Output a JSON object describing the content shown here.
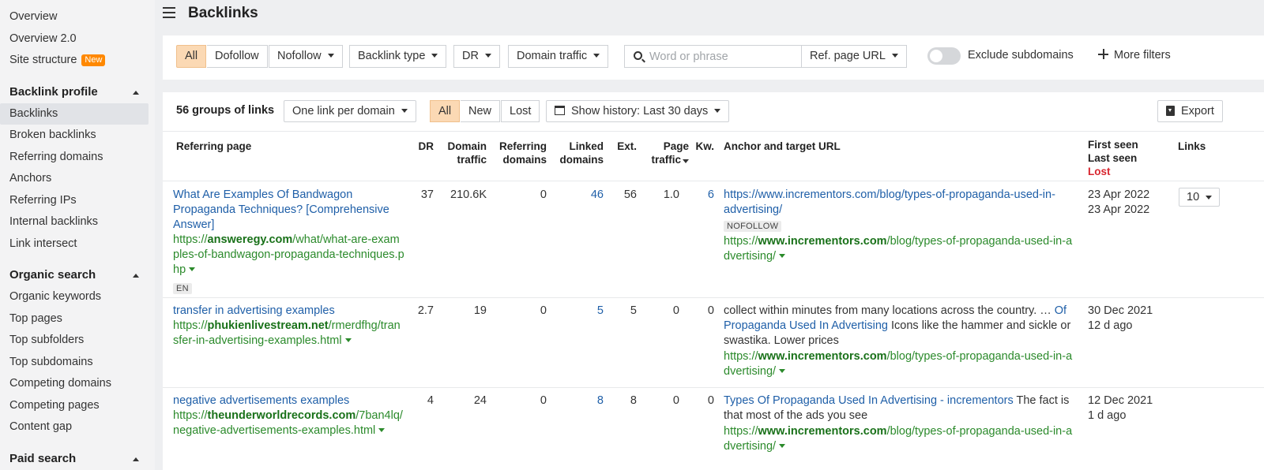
{
  "sidebar": {
    "top_items": [
      "Overview",
      "Overview 2.0",
      "Site structure"
    ],
    "new_badge": "New",
    "backlink_profile": {
      "title": "Backlink profile",
      "items": [
        "Backlinks",
        "Broken backlinks",
        "Referring domains",
        "Anchors",
        "Referring IPs",
        "Internal backlinks",
        "Link intersect"
      ]
    },
    "organic_search": {
      "title": "Organic search",
      "items": [
        "Organic keywords",
        "Top pages",
        "Top subfolders",
        "Top subdomains",
        "Competing domains",
        "Competing pages",
        "Content gap"
      ]
    },
    "paid_search": {
      "title": "Paid search"
    }
  },
  "header": {
    "title": "Backlinks"
  },
  "filters": {
    "all": "All",
    "dofollow": "Dofollow",
    "nofollow": "Nofollow",
    "backlink_type": "Backlink type",
    "dr": "DR",
    "domain_traffic": "Domain traffic",
    "search_placeholder": "Word or phrase",
    "ref_page_url": "Ref. page URL",
    "exclude_subdomains": "Exclude subdomains",
    "more_filters": "More filters"
  },
  "toolbar": {
    "groups": "56 groups of links",
    "grouping": "One link per domain",
    "all": "All",
    "new": "New",
    "lost": "Lost",
    "history": "Show history: Last 30 days",
    "export": "Export"
  },
  "columns": {
    "referring_page": "Referring page",
    "dr": "DR",
    "domain_traffic_1": "Domain",
    "domain_traffic_2": "traffic",
    "referring_domains_1": "Referring",
    "referring_domains_2": "domains",
    "linked_domains_1": "Linked",
    "linked_domains_2": "domains",
    "ext": "Ext.",
    "page_traffic_1": "Page",
    "page_traffic_2": "traffic",
    "kw": "Kw.",
    "anchor": "Anchor and target URL",
    "first_seen": "First seen",
    "last_seen": "Last seen",
    "lost": "Lost",
    "links": "Links"
  },
  "rows": [
    {
      "title": [
        "What Are Examples Of Bandwagon",
        "Propaganda Techniques? [Comprehensive",
        "Answer]"
      ],
      "url_prefix": "https://",
      "url_domain": "answeregy.com",
      "url_rest_1": "/what/what-are-exam",
      "url_rest_2": "ples-of-bandwagon-propaganda-techniques.p",
      "url_rest_3": "hp",
      "lang": "EN",
      "dr": "37",
      "domain_traffic": "210.6K",
      "referring_domains": "0",
      "linked_domains": "46",
      "ext": "56",
      "page_traffic": "1.0",
      "kw": "6",
      "anchor_1": "https://www.incrementors.com/blog/types-of-propaganda-used-in-",
      "anchor_2": "advertising/",
      "nofollow": "NOFOLLOW",
      "target_prefix": "https://",
      "target_domain": "www.incrementors.com",
      "target_rest_1": "/blog/types-of-propaganda-used-in-a",
      "target_rest_2": "dvertising/",
      "first_seen": "23 Apr 2022",
      "last_seen": "23 Apr 2022",
      "links": "10"
    },
    {
      "title": [
        "transfer in advertising examples"
      ],
      "url_prefix": "https://",
      "url_domain": "phukienlivestream.net",
      "url_rest_1": "/rmerdfhg/tran",
      "url_rest_2": "sfer-in-advertising-examples.html",
      "dr": "2.7",
      "domain_traffic": "19",
      "referring_domains": "0",
      "linked_domains": "5",
      "ext": "5",
      "page_traffic": "0",
      "kw": "0",
      "anchor_text_1": "collect within minutes from many locations across the country. … ",
      "anchor_link_1": "Of",
      "anchor_link_2": "Propaganda Used In Advertising",
      "anchor_text_2": " Icons like the hammer and sickle or",
      "anchor_text_3": "swastika. Lower prices",
      "target_prefix": "https://",
      "target_domain": "www.incrementors.com",
      "target_rest_1": "/blog/types-of-propaganda-used-in-a",
      "target_rest_2": "dvertising/",
      "first_seen": "30 Dec 2021",
      "last_seen": "12 d ago"
    },
    {
      "title": [
        "negative advertisements examples"
      ],
      "url_prefix": "https://",
      "url_domain": "theunderworldrecords.com",
      "url_rest_1": "/7ban4lq/",
      "url_rest_2": "negative-advertisements-examples.html",
      "dr": "4",
      "domain_traffic": "24",
      "referring_domains": "0",
      "linked_domains": "8",
      "ext": "8",
      "page_traffic": "0",
      "kw": "0",
      "anchor_link_1": "Types Of Propaganda Used In Advertising - incrementors",
      "anchor_text_1": " The fact is",
      "anchor_text_2": "that most of the ads you see",
      "target_prefix": "https://",
      "target_domain": "www.incrementors.com",
      "target_rest_1": "/blog/types-of-propaganda-used-in-a",
      "target_rest_2": "dvertising/",
      "first_seen": "12 Dec 2021",
      "last_seen": "1 d ago"
    }
  ]
}
